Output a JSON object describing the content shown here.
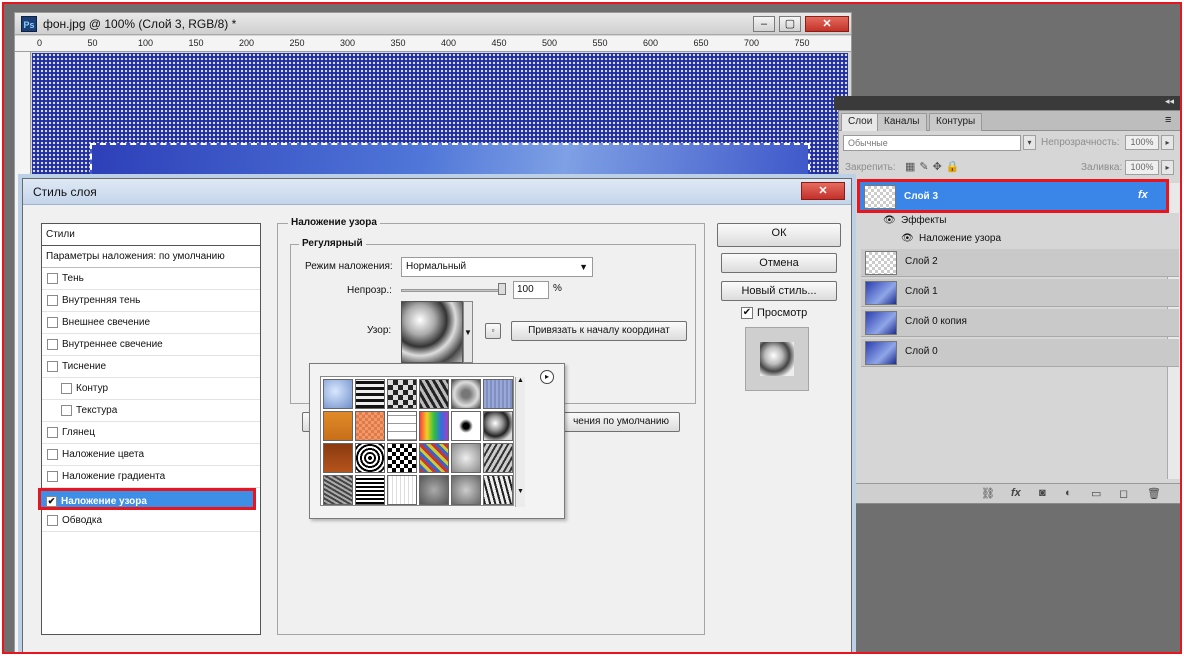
{
  "document": {
    "title": "фон.jpg @ 100% (Слой 3, RGB/8) *",
    "ps_badge": "Ps",
    "ruler_ticks": [
      "0",
      "50",
      "100",
      "150",
      "200",
      "250",
      "300",
      "350",
      "400",
      "450",
      "500",
      "550",
      "600",
      "650",
      "700",
      "750"
    ],
    "win_buttons": {
      "minimize": "‒",
      "maximize": "▢",
      "close": "✕"
    }
  },
  "layers_panel": {
    "collapse_glyph": "◂◂",
    "tabs": [
      "Слои",
      "Каналы",
      "Контуры"
    ],
    "menu_glyph": "≡",
    "blend_mode": "Обычные",
    "opacity_label": "Непрозрачность:",
    "opacity_value": "100%",
    "lock_label": "Закрепить:",
    "fill_label": "Заливка:",
    "fill_value": "100%",
    "layers": [
      {
        "name": "Слой 3",
        "selected": true,
        "fx": "fx"
      },
      {
        "name": "Слой 2",
        "selected": false
      },
      {
        "name": "Слой 1",
        "selected": false
      },
      {
        "name": "Слой 0 копия",
        "selected": false
      },
      {
        "name": "Слой 0",
        "selected": false
      }
    ],
    "effects_label": "Эффекты",
    "effect_item": "Наложение узора"
  },
  "dialog": {
    "title": "Стиль слоя",
    "close_glyph": "✕",
    "styles_header": "Стили",
    "blend_params": "Параметры наложения: по умолчанию",
    "style_items": [
      {
        "label": "Тень",
        "checked": false,
        "indent": false
      },
      {
        "label": "Внутренняя тень",
        "checked": false,
        "indent": false
      },
      {
        "label": "Внешнее свечение",
        "checked": false,
        "indent": false
      },
      {
        "label": "Внутреннее свечение",
        "checked": false,
        "indent": false
      },
      {
        "label": "Тиснение",
        "checked": false,
        "indent": false
      },
      {
        "label": "Контур",
        "checked": false,
        "indent": true
      },
      {
        "label": "Текстура",
        "checked": false,
        "indent": true
      },
      {
        "label": "Глянец",
        "checked": false,
        "indent": false
      },
      {
        "label": "Наложение цвета",
        "checked": false,
        "indent": false
      },
      {
        "label": "Наложение градиента",
        "checked": false,
        "indent": false
      },
      {
        "label": "Наложение узора",
        "checked": true,
        "indent": false,
        "selected": true
      },
      {
        "label": "Обводка",
        "checked": false,
        "indent": false
      }
    ],
    "section_title": "Наложение узора",
    "subsection_title": "Регулярный",
    "blend_mode_label": "Режим наложения:",
    "blend_mode_value": "Нормальный",
    "opacity_label": "Непрозр.:",
    "opacity_value": "100",
    "percent": "%",
    "pattern_label": "Узор:",
    "snap_button": "Привязать к началу координат",
    "default_button_partial": "чения по умолчанию",
    "ok_button": "ОК",
    "cancel_button": "Отмена",
    "new_style_button": "Новый стиль...",
    "preview_label": "Просмотр",
    "preview_checked": true
  },
  "pattern_picker": {
    "selected_index": 11,
    "menu_glyph": "▸",
    "scroll_up": "▲",
    "scroll_down": "▼"
  },
  "colors": {
    "highlight_red": "#e8141e",
    "selection_blue": "#3d8ee6",
    "canvas_blue": "#1f2c9c"
  }
}
